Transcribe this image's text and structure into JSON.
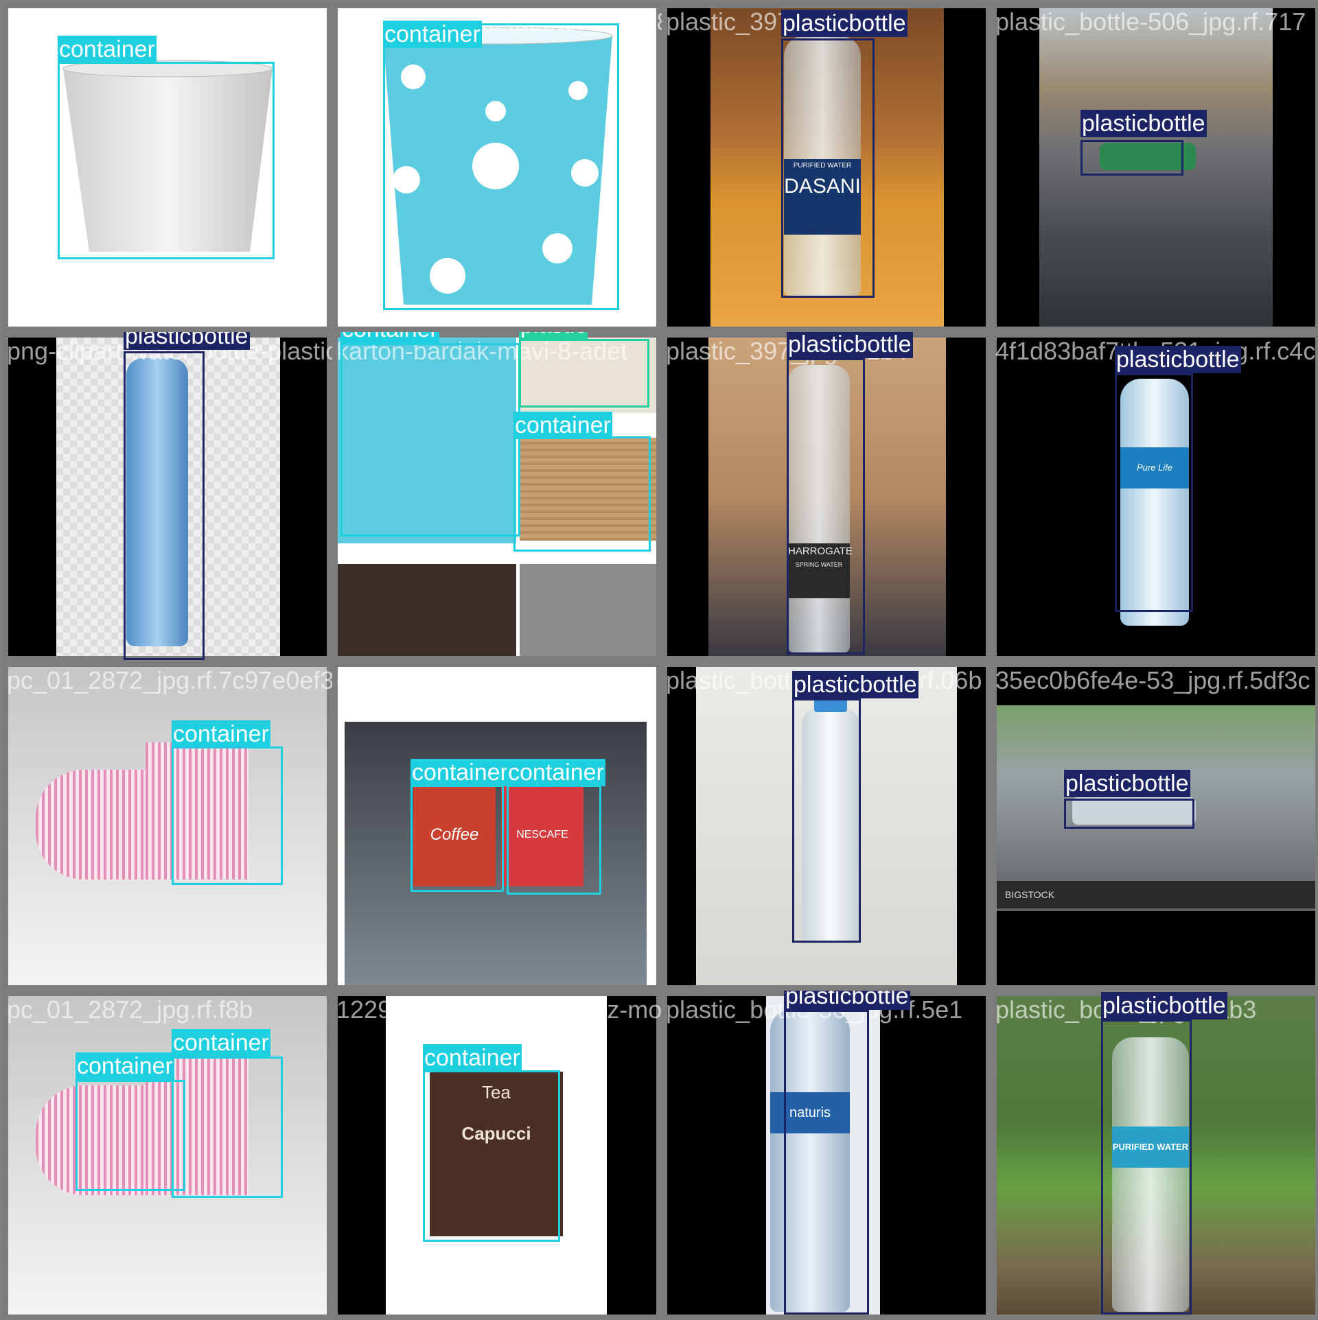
{
  "classes": {
    "container": "container",
    "plasticbottle": "plasticbottle",
    "plastic": "plastic"
  },
  "colors": {
    "container": "#1ecfe0",
    "plasticbottle": "#1c2466",
    "plastic": "#25d0a0",
    "separator": "#808080"
  },
  "tiles": [
    {
      "filename": "plc01_jpg.rf.77ea38b22493",
      "boxes": [
        "container"
      ]
    },
    {
      "filename": "b4ab545576394a2dak_mavi-8-adet_12",
      "boxes": [
        "container"
      ]
    },
    {
      "filename": "plastic_397",
      "boxes": [
        "plasticbottle"
      ]
    },
    {
      "filename": "plastic_bottle-506_jpg.rf.717",
      "boxes": [
        "plasticbottle"
      ]
    },
    {
      "filename": "png-clipart-water-bottle-plastic-bottle",
      "boxes": [
        "plasticbottle"
      ]
    },
    {
      "filename": "karton-bardak-mavi-8-adet",
      "boxes": [
        "container",
        "plastic",
        "container"
      ]
    },
    {
      "filename": "plastic_397_jpg.rf.1b4",
      "boxes": [
        "plasticbottle"
      ]
    },
    {
      "filename": "4f1d83baf7ttle-531_jpg.rf.c4c",
      "boxes": [
        "plasticbottle"
      ]
    },
    {
      "filename": "pc_01_2872_jpg.rf.7c97e0ef3d8e",
      "boxes": [
        "container"
      ]
    },
    {
      "filename": "disposable-paper-cups",
      "boxes": [
        "container",
        "container"
      ]
    },
    {
      "filename": "plastic_bottle_294_jpg.rf.06b",
      "boxes": [
        "plasticbottle"
      ]
    },
    {
      "filename": "35ec0b6fe4e-53_jpg.rf.5df3c",
      "boxes": [
        "plasticbottle"
      ]
    },
    {
      "filename": "pc_01_2872_jpg.rf.f8b",
      "boxes": [
        "container",
        "container"
      ]
    },
    {
      "filename": "12298_karton-bardak-7oz-model-2",
      "boxes": [
        "container"
      ]
    },
    {
      "filename": "plastic_bottle-36_jpg.rf.5e1",
      "boxes": [
        "plasticbottle"
      ]
    },
    {
      "filename": "plastic_bottle_jpg.rf.ab3",
      "boxes": [
        "plasticbottle"
      ]
    }
  ],
  "product_text": {
    "dasani": "DASANI",
    "dasani_sub": "PURIFIED WATER",
    "harrogate": "HARROGATE",
    "harrogate_sub": "SPRING WATER",
    "nestle": "Pure Life",
    "coffee": "Coffee",
    "nescafe": "NESCAFE",
    "bigstock": "BIGSTOCK",
    "naturis": "naturis",
    "purified": "PURIFIED WATER",
    "tea": "Tea",
    "capucci": "Capucci"
  }
}
